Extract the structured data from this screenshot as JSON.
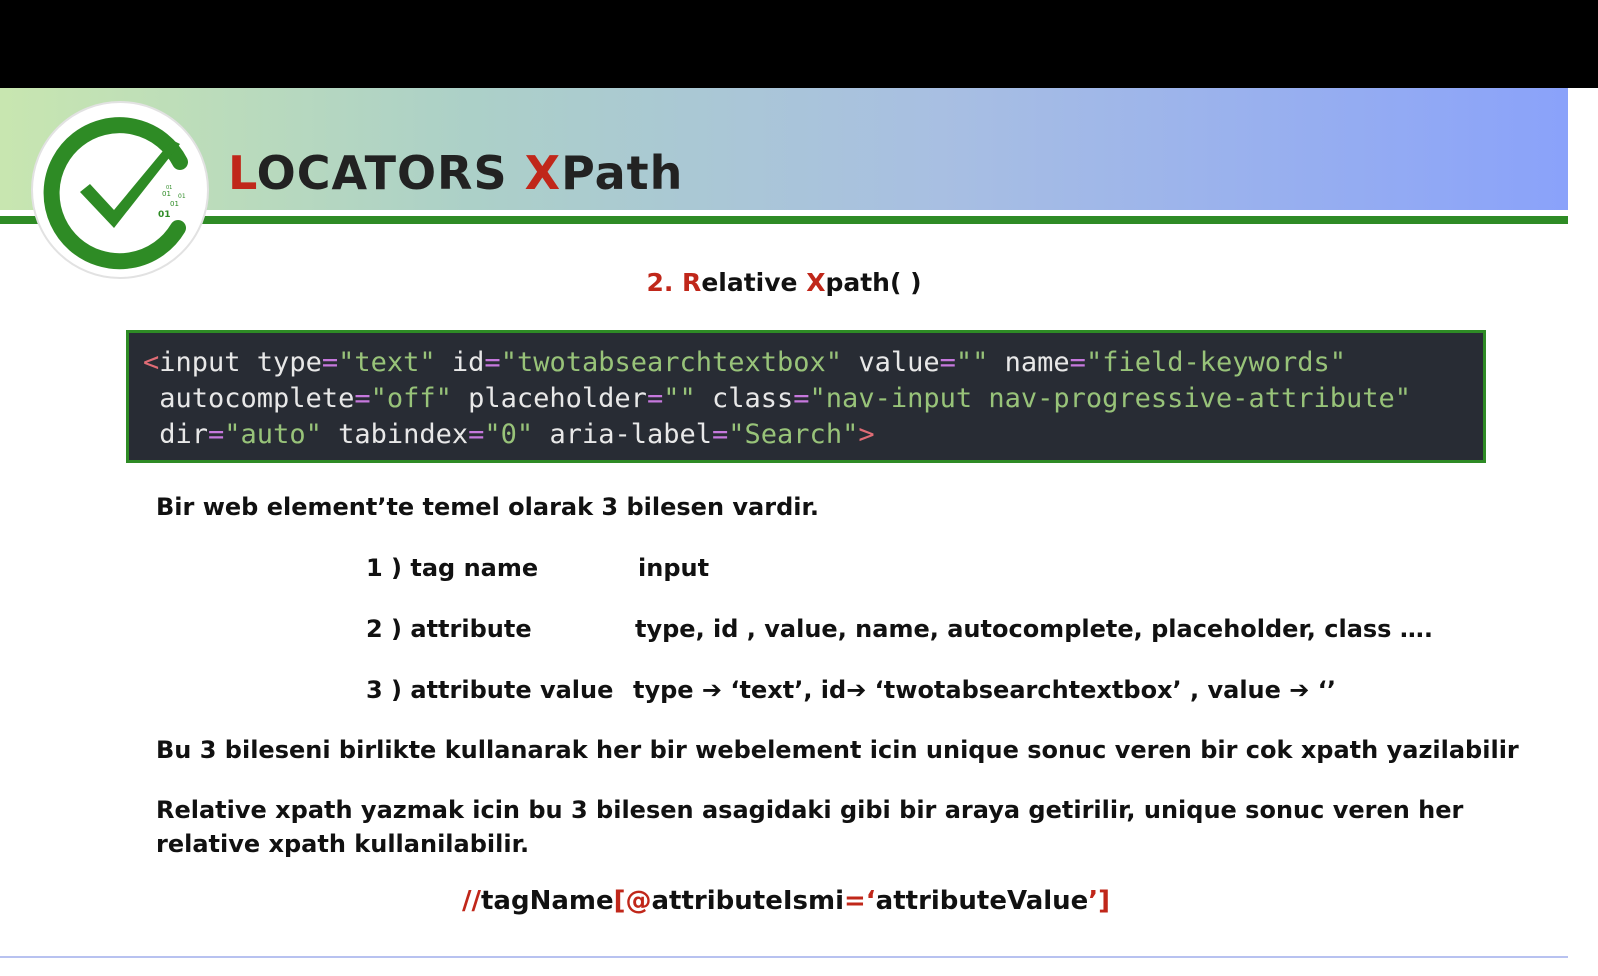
{
  "header": {
    "title_first_letter": "L",
    "title_rest": "OCATORS ",
    "title_x": "X",
    "title_path": "Path",
    "logo_digits": [
      "01",
      "01",
      "01",
      "01",
      "01"
    ]
  },
  "subtitle": {
    "prefix": "2. ",
    "r": "R",
    "elative": "elative ",
    "x": "X",
    "rest": "path( )"
  },
  "code": {
    "line1": {
      "open": "<",
      "tag": "input",
      "parts": [
        {
          "attr": " type",
          "eq": "=",
          "val": "\"text\""
        },
        {
          "attr": " id",
          "eq": "=",
          "val": "\"twotabsearchtextbox\""
        },
        {
          "attr": " value",
          "eq": "=",
          "val": "\"\""
        },
        {
          "attr": " name",
          "eq": "=",
          "val": "\"field-keywords\""
        }
      ]
    },
    "line2": {
      "parts": [
        {
          "attr": " autocomplete",
          "eq": "=",
          "val": "\"off\""
        },
        {
          "attr": " placeholder",
          "eq": "=",
          "val": "\"\""
        },
        {
          "attr": " class",
          "eq": "=",
          "val": "\"nav-input nav-progressive-attribute\""
        }
      ]
    },
    "line3": {
      "parts": [
        {
          "attr": " dir",
          "eq": "=",
          "val": "\"auto\""
        },
        {
          "attr": " tabindex",
          "eq": "=",
          "val": "\"0\""
        },
        {
          "attr": " aria-label",
          "eq": "=",
          "val": "\"Search\""
        }
      ],
      "close": ">"
    }
  },
  "intro": "Bir web element’te temel olarak 3 bilesen vardir.",
  "components": [
    {
      "label": "1 )  tag name",
      "value": "input"
    },
    {
      "label": "2 )  attribute",
      "value": "type, id , value, name, autocomplete, placeholder, class …."
    },
    {
      "label": "3 ) attribute value",
      "value": "type ➔ ‘text’, id➔ ‘twotabsearchtextbox’ , value ➔ ‘’"
    }
  ],
  "paragraph1": "Bu 3 bileseni birlikte kullanarak her bir webelement icin unique sonuc veren bir cok xpath yazilabilir",
  "paragraph2_line1": "Relative xpath yazmak icin bu 3 bilesen asagidaki gibi bir araya getirilir, unique sonuc veren her",
  "paragraph2_line2": "relative xpath kullanilabilir.",
  "formula": {
    "slashes": "//",
    "tag": "tagName",
    "open": "[@",
    "attr": "attributeIsmi",
    "eq": "=‘",
    "value": "attributeValue",
    "close": "’]"
  },
  "colors": {
    "accent_red": "#c0271a",
    "green": "#2e8b25",
    "code_bg": "#282c34"
  }
}
